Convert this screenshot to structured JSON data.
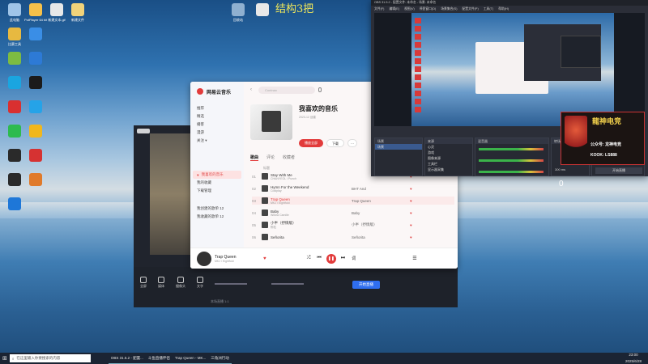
{
  "desktop": {
    "watermark": "结构3把",
    "icons": [
      {
        "label": "此电脑",
        "color": "#9fc4e8"
      },
      {
        "label": "PotPlayer 64 bit",
        "color": "#f6c14a"
      },
      {
        "label": "新建文本.gif",
        "color": "#e8e8e8"
      },
      {
        "label": "新建文件",
        "color": "#f1d37a"
      },
      {
        "label": "",
        "color": "#e8e8e8"
      },
      {
        "label": "回收站",
        "color": "#8fb0d0"
      },
      {
        "label": "比赛工具",
        "color": "#e7b940"
      },
      {
        "label": "",
        "color": "#3a8ee6"
      },
      {
        "label": "",
        "color": "#7dbb42"
      },
      {
        "label": "",
        "color": "#2d7ad6"
      },
      {
        "label": "",
        "color": "#1aa5e0"
      },
      {
        "label": "",
        "color": "#1b1b1b"
      },
      {
        "label": "",
        "color": "#d93030"
      },
      {
        "label": "",
        "color": "#25a3e8"
      },
      {
        "label": "",
        "color": "#2dbb4f"
      },
      {
        "label": "",
        "color": "#f1b71c"
      },
      {
        "label": "",
        "color": "#2a2a2a"
      },
      {
        "label": "",
        "color": "#d63232"
      },
      {
        "label": "",
        "color": "#2a2a2a"
      },
      {
        "label": "",
        "color": "#e07a2a"
      },
      {
        "label": "",
        "color": "#1e77d8"
      }
    ]
  },
  "taskbar": {
    "search_placeholder": "在这里输入你要搜索的内容",
    "items": [
      "OBS 31.5.2 - 配置...",
      "斗鱼直播伴侣",
      "Trap Queen - MK...",
      "三角洲行动"
    ],
    "time": "23:00",
    "date": "2025/6/28"
  },
  "music": {
    "app_name": "网易云音乐",
    "search_placeholder": "Contnax",
    "sidebar": [
      "推荐",
      "精选",
      "播客",
      "漫游",
      "关注 ▾"
    ],
    "sidebar_sections": [
      "我喜欢的音乐",
      "我的收藏",
      "下载管理",
      "我创建的歌单 12",
      "我收藏的歌单 12"
    ],
    "playlist_title": "我喜欢的音乐",
    "playlist_meta": "2023-12 创建",
    "play_all": "播放全部",
    "download": "下载",
    "tabs": [
      "歌曲",
      "评论",
      "收藏者"
    ],
    "col_title": "标题",
    "col_album": "专辑",
    "tracks": [
      {
        "n": "01",
        "title": "Stay With Me",
        "sub": "CHANYEOL / Punch",
        "album": ""
      },
      {
        "n": "02",
        "title": "Hymn For the Weekend",
        "sub": "Coldplay",
        "album": "BHT And"
      },
      {
        "n": "03",
        "title": "Trap Queen",
        "sub": "MKJ / Eightfold",
        "album": "Trap Queen"
      },
      {
        "n": "04",
        "title": "Baby",
        "sub": "Willow Camille",
        "album": "Baby"
      },
      {
        "n": "05",
        "title": "小半（抒情版）",
        "sub": "陈粒",
        "album": "小半（抒情版）"
      },
      {
        "n": "06",
        "title": "Señorita",
        "sub": "",
        "album": "Señorita"
      }
    ],
    "now_playing": "Trap Queen",
    "now_artist": "MKJ / Eightfold"
  },
  "obs": {
    "title": "OBS 31.5.2 - 配置文件: 未命名 - 场景: 未命名",
    "menu": [
      "文件(F)",
      "编辑(E)",
      "视图(V)",
      "停靠窗口(D)",
      "场景集合(S)",
      "配置文件(P)",
      "工具(T)",
      "帮助(H)"
    ],
    "scenes_header": "场景",
    "scenes": [
      "场景"
    ],
    "sources_header": "来源",
    "sources": [
      "心灵",
      "游戏",
      "图像来源",
      "工具栏",
      "显示器采集"
    ],
    "mixer_header": "混音器",
    "transition_header": "转场",
    "controls": [
      "开始直播",
      "开始录制",
      "开始虚拟摄像机",
      "工作室模式",
      "设置",
      "退出"
    ],
    "stat_zero": "0",
    "duration": "300 ms"
  },
  "ad": {
    "title": "龍神电竞",
    "line1": "公众号: 龙神电竞",
    "line2": "KOOK: LS888"
  },
  "streamer": {
    "bottom_btns": [
      "全屏",
      "媒体",
      "摄像头",
      "文字",
      "小游戏"
    ],
    "start_btn": "开始直播",
    "footer": "本场直播 1:1"
  }
}
